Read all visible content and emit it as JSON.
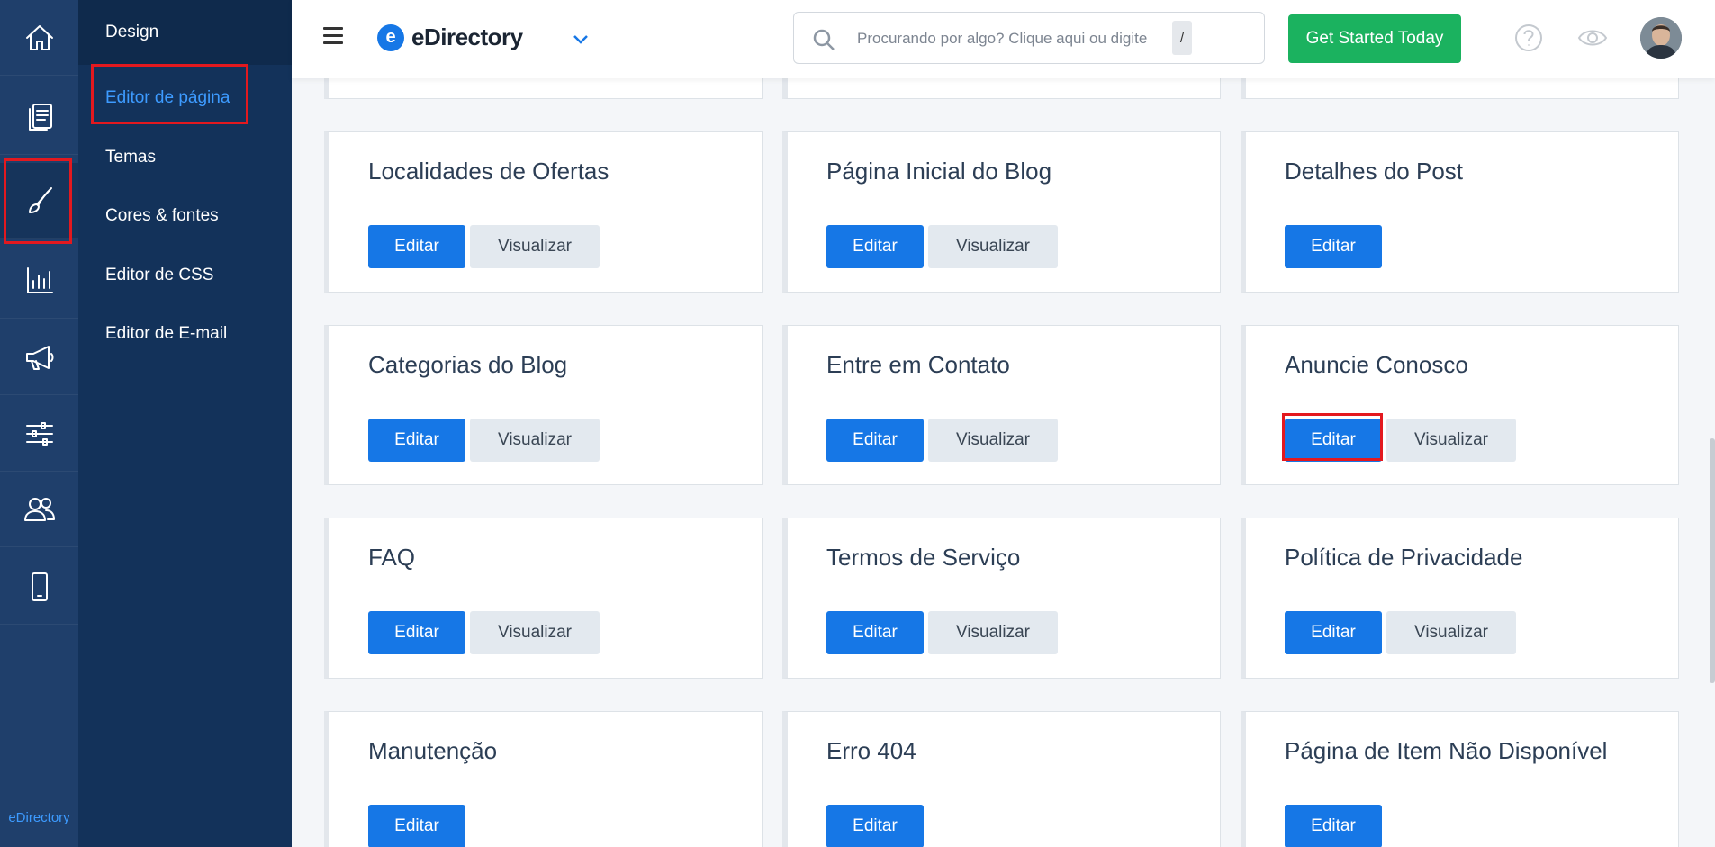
{
  "rail": {
    "items": [
      "home",
      "pages",
      "design",
      "reports",
      "promote",
      "settings",
      "users",
      "mobile"
    ],
    "active": "design",
    "brand": "eDirectory"
  },
  "submenu": {
    "heading": "Design",
    "items": [
      {
        "label": "Editor de página",
        "active": true
      },
      {
        "label": "Temas",
        "active": false
      },
      {
        "label": "Cores & fontes",
        "active": false
      },
      {
        "label": "Editor de CSS",
        "active": false
      },
      {
        "label": "Editor de E-mail",
        "active": false
      }
    ]
  },
  "header": {
    "logo_text": "eDirectory",
    "logo_letter": "e",
    "search_placeholder": "Procurando por algo? Clique aqui ou digite",
    "search_shortcut": "/",
    "cta_label": "Get Started Today",
    "help_icon": "question-circle-icon",
    "preview_icon": "eye-icon"
  },
  "buttons": {
    "edit": "Editar",
    "view": "Visualizar"
  },
  "cards": [
    {
      "title": "Localidades de Ofertas",
      "has_view": true
    },
    {
      "title": "Página Inicial do Blog",
      "has_view": true
    },
    {
      "title": "Detalhes do Post",
      "has_view": false
    },
    {
      "title": "Categorias do Blog",
      "has_view": true
    },
    {
      "title": "Entre em Contato",
      "has_view": true
    },
    {
      "title": "Anuncie Conosco",
      "has_view": true,
      "highlighted_edit": true
    },
    {
      "title": "FAQ",
      "has_view": true
    },
    {
      "title": "Termos de Serviço",
      "has_view": true
    },
    {
      "title": "Política de Privacidade",
      "has_view": true
    },
    {
      "title": "Manutenção",
      "has_view": false
    },
    {
      "title": "Erro 404",
      "has_view": false
    },
    {
      "title": "Página de Item Não Disponível",
      "has_view": false
    }
  ],
  "colors": {
    "primary": "#1677e6",
    "success": "#1bb25f",
    "rail": "#1f3f6b",
    "submenu": "#13325a",
    "highlight": "#e3191f"
  }
}
